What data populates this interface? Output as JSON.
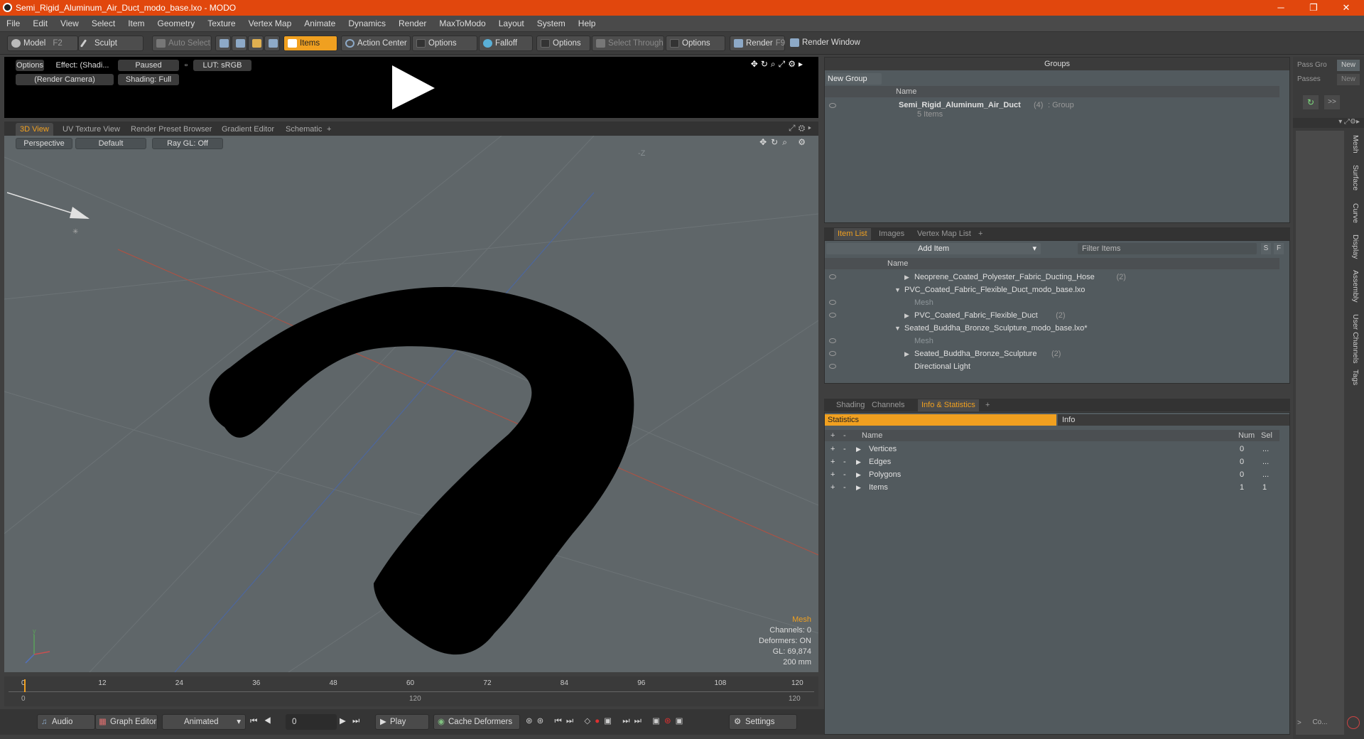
{
  "window": {
    "title": "Semi_Rigid_Aluminum_Air_Duct_modo_base.lxo - MODO",
    "minimize": "─",
    "maximize": "❐",
    "close": "✕"
  },
  "menu": [
    "File",
    "Edit",
    "View",
    "Select",
    "Item",
    "Geometry",
    "Texture",
    "Vertex Map",
    "Animate",
    "Dynamics",
    "Render",
    "MaxToModo",
    "Layout",
    "System",
    "Help"
  ],
  "toolbar": {
    "model": "Model",
    "model_key": "F2",
    "sculpt": "Sculpt",
    "auto_select": "Auto Select",
    "items": "Items",
    "action_center": "Action Center",
    "options1": "Options",
    "falloff": "Falloff",
    "options2": "Options",
    "select_through": "Select Through",
    "options3": "Options",
    "render": "Render",
    "render_key": "F9",
    "render_window": "Render Window"
  },
  "preview": {
    "options": "Options",
    "effect": "Effect: (Shadi...",
    "paused": "Paused",
    "lut": "LUT: sRGB",
    "camera": "(Render Camera)",
    "shading": "Shading: Full"
  },
  "view_tabs": [
    "3D View",
    "UV Texture View",
    "Render Preset Browser",
    "Gradient Editor",
    "Schematic",
    "+"
  ],
  "viewport": {
    "perspective": "Perspective",
    "default": "Default",
    "raygl": "Ray GL: Off",
    "axis_label": "-Z",
    "info": {
      "selection": "Mesh",
      "channels": "Channels: 0",
      "deformers": "Deformers: ON",
      "gl": "GL: 69,874",
      "scale": "200 mm"
    }
  },
  "timeline": {
    "ticks": [
      "0",
      "12",
      "24",
      "36",
      "48",
      "60",
      "72",
      "84",
      "96",
      "108",
      "120"
    ],
    "range_start": "0",
    "range_mid": "120",
    "range_end": "120"
  },
  "bottombar": {
    "audio": "Audio",
    "graph_editor": "Graph Editor",
    "animated": "Animated",
    "frame": "0",
    "play": "Play",
    "cache_deformers": "Cache Deformers",
    "settings": "Settings"
  },
  "groups": {
    "header": "Groups",
    "new_group": "New Group",
    "col_name": "Name",
    "group_name": "Semi_Rigid_Aluminum_Air_Duct",
    "group_count": "(4)",
    "group_type": ": Group",
    "group_items": "5 Items"
  },
  "item_list": {
    "tabs": [
      "Item List",
      "Images",
      "Vertex Map List",
      "+"
    ],
    "add_item": "Add Item",
    "filter_placeholder": "Filter Items",
    "s_btn": "S",
    "f_btn": "F",
    "col_name": "Name",
    "rows": [
      {
        "label": "Neoprene_Coated_Polyester_Fabric_Ducting_Hose",
        "count": "(2)",
        "dim": false
      },
      {
        "label": "PVC_Coated_Fabric_Flexible_Duct_modo_base.lxo",
        "count": "",
        "dim": false
      },
      {
        "label": "Mesh",
        "count": "",
        "dim": true
      },
      {
        "label": "PVC_Coated_Fabric_Flexible_Duct",
        "count": "(2)",
        "dim": false
      },
      {
        "label": "Seated_Buddha_Bronze_Sculpture_modo_base.lxo*",
        "count": "",
        "dim": false
      },
      {
        "label": "Mesh",
        "count": "",
        "dim": true
      },
      {
        "label": "Seated_Buddha_Bronze_Sculpture",
        "count": "(2)",
        "dim": false
      },
      {
        "label": "Directional Light",
        "count": "",
        "dim": false
      }
    ]
  },
  "stats": {
    "tabs": [
      "Shading",
      "Channels",
      "Info & Statistics",
      "+"
    ],
    "statistics": "Statistics",
    "info": "Info",
    "col_name": "Name",
    "col_num": "Num",
    "col_sel": "Sel",
    "rows": [
      {
        "name": "Vertices",
        "num": "0",
        "sel": "..."
      },
      {
        "name": "Edges",
        "num": "0",
        "sel": "..."
      },
      {
        "name": "Polygons",
        "num": "0",
        "sel": "..."
      },
      {
        "name": "Items",
        "num": "1",
        "sel": "1"
      }
    ]
  },
  "right_strip": {
    "pass_groups": "Pass Gro",
    "passes": "Passes",
    "new1": "New",
    "new2": "New",
    "more": ">>",
    "vtabs": [
      "Mesh",
      "Surface",
      "Curve",
      "Display",
      "Assembly",
      "User Channels",
      "Tags"
    ],
    "bottom": "Co..."
  },
  "colors": {
    "accent": "#f0a020",
    "titlebar": "#e1470d",
    "viewport": "#5f6669"
  }
}
